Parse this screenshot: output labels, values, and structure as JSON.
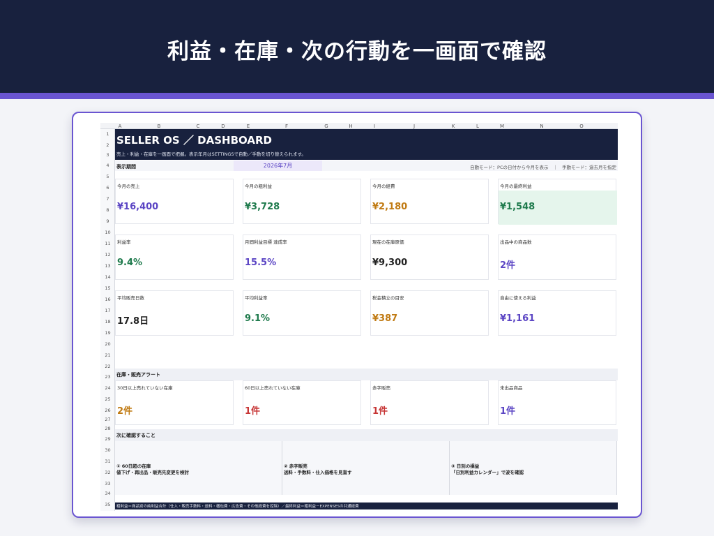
{
  "hero": {
    "title": "利益・在庫・次の行動を一画面で確認"
  },
  "colors": {
    "navy": "#18213e",
    "accent": "#6a55d1",
    "purple": "#5b45c4",
    "green": "#1e7a4c",
    "orange": "#c07a12",
    "red": "#c73636",
    "dark": "#222222"
  },
  "sheet": {
    "columns": [
      "A",
      "B",
      "C",
      "D",
      "E",
      "F",
      "G",
      "H",
      "I",
      "J",
      "K",
      "L",
      "M",
      "N",
      "O"
    ],
    "rows": [
      "1",
      "2",
      "3",
      "4",
      "5",
      "6",
      "7",
      "8",
      "9",
      "10",
      "11",
      "12",
      "13",
      "14",
      "15",
      "16",
      "17",
      "18",
      "19",
      "20",
      "21",
      "22",
      "23",
      "24",
      "25",
      "26",
      "27",
      "28",
      "29",
      "30",
      "31",
      "32",
      "33",
      "34",
      "35"
    ],
    "title": "SELLER OS ／ DASHBOARD",
    "subtitle": "売上・利益・在庫を一画面で把握。表示年月はSETTINGSで自動／手動を切り替えられます。",
    "period_label": "表示期間",
    "period_value": "2026年7月",
    "period_note": "自動モード：PCの日付から今月を表示　｜　手動モード：過去月を指定",
    "kpis": [
      {
        "label": "今月の売上",
        "value": "¥16,400",
        "color": "purple"
      },
      {
        "label": "今月の粗利益",
        "value": "¥3,728",
        "color": "green"
      },
      {
        "label": "今月の経費",
        "value": "¥2,180",
        "color": "orange"
      },
      {
        "label": "今月の最終利益",
        "value": "¥1,548",
        "color": "green"
      },
      {
        "label": "利益率",
        "value": "9.4%",
        "color": "green"
      },
      {
        "label": "月間利益目標 達成率",
        "value": "15.5%",
        "color": "purple"
      },
      {
        "label": "現在の在庫原価",
        "value": "¥9,300",
        "color": "dark"
      },
      {
        "label": "出品中の商品数",
        "value": "2件",
        "color": "purple"
      },
      {
        "label": "平均販売日数",
        "value": "17.8日",
        "color": "dark"
      },
      {
        "label": "平均利益率",
        "value": "9.1%",
        "color": "green"
      },
      {
        "label": "税金積立の目安",
        "value": "¥387",
        "color": "orange"
      },
      {
        "label": "自由に使える利益",
        "value": "¥1,161",
        "color": "purple"
      }
    ],
    "alert_section": "在庫・販売アラート",
    "alerts": [
      {
        "label": "30日以上売れていない在庫",
        "value": "2件",
        "color": "orange"
      },
      {
        "label": "60日以上売れていない在庫",
        "value": "1件",
        "color": "red"
      },
      {
        "label": "赤字販売",
        "value": "1件",
        "color": "red"
      },
      {
        "label": "未出品商品",
        "value": "1件",
        "color": "purple"
      }
    ],
    "next_section": "次に確認すること",
    "next": [
      {
        "title": "① 60日超の在庫",
        "action": "値下げ・再出品・販売先変更を検討"
      },
      {
        "title": "② 赤字販売",
        "action": "送料・手数料・仕入価格を見直す"
      },
      {
        "title": "③ 日別の損益",
        "action": "「日別利益カレンダー」で波を確認"
      }
    ],
    "footer": "粗利益＝商品別の純利益合計（仕入・販売手数料・送料・梱包費・広告費・その他経費を控除）／最終利益＝粗利益－EXPENSESの共通経費"
  }
}
